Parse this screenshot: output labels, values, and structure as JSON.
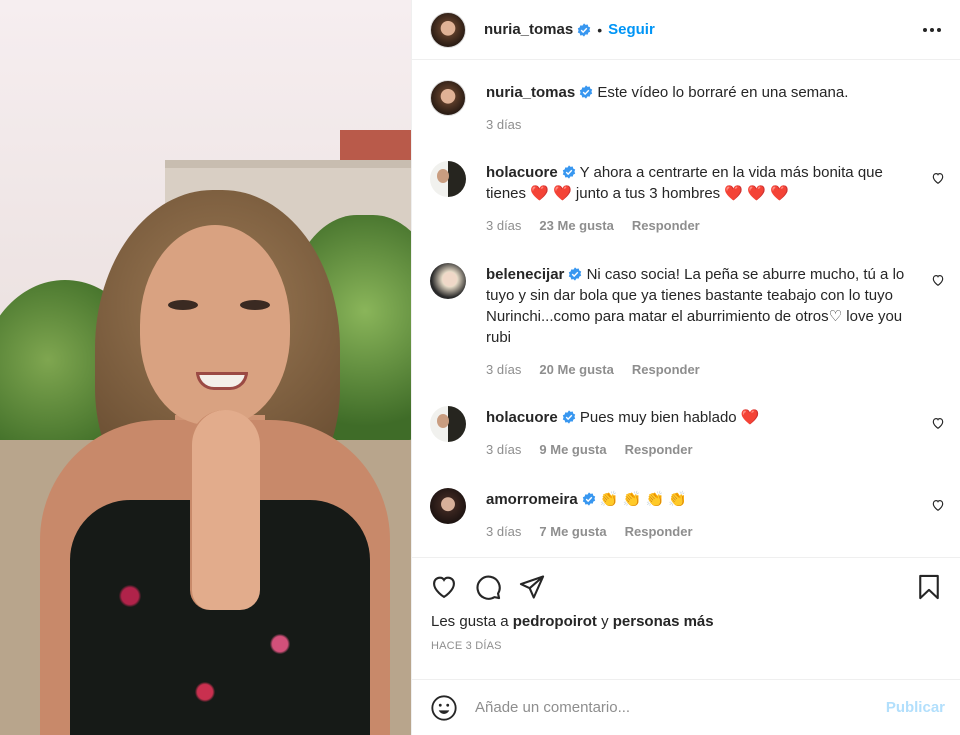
{
  "post": {
    "author": "nuria_tomas",
    "follow_label": "Seguir",
    "dot": "•",
    "more_icon": "more-horizontal-icon"
  },
  "caption": {
    "username": "nuria_tomas",
    "text": "Este vídeo lo borraré en una semana.",
    "time": "3 días"
  },
  "comments": [
    {
      "username": "holacuore",
      "text_line1": "Y ahora a centrarte en la vida más bonita que",
      "text_line2a": "tienes",
      "hearts_a": "❤️ ❤️",
      "text_line2b": "junto a tus 3 hombres",
      "hearts_b": "❤️ ❤️ ❤️",
      "time": "3 días",
      "likes": "23 Me gusta",
      "reply": "Responder"
    },
    {
      "username": "belenecijar",
      "text": "Ni caso socia! La peña se aburre mucho, tú a lo tuyo y sin dar bola que ya tienes bastante teabajo con lo tuyo Nurinchi...como para matar el aburrimiento de otros♡ love you rubi",
      "time": "3 días",
      "likes": "20 Me gusta",
      "reply": "Responder"
    },
    {
      "username": "holacuore",
      "text": "Pues muy bien hablado",
      "hearts": "❤️",
      "time": "3 días",
      "likes": "9 Me gusta",
      "reply": "Responder"
    },
    {
      "username": "amorromeira",
      "text": "👏 👏 👏 👏",
      "time": "3 días",
      "likes": "7 Me gusta",
      "reply": "Responder"
    }
  ],
  "likes_summary": {
    "prefix": "Les gusta a",
    "user": "pedropoirot",
    "conj": "y",
    "others": "personas más"
  },
  "date_label": "Hace 3 días",
  "comment_box": {
    "placeholder": "Añade un comentario...",
    "publish": "Publicar"
  },
  "colors": {
    "accent": "#0095f6",
    "verified": "#3897f0",
    "like_red": "#ed4956"
  }
}
